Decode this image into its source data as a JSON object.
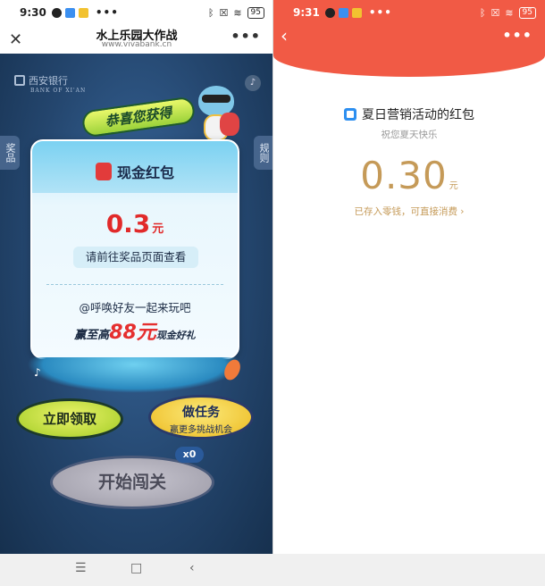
{
  "left": {
    "status": {
      "time": "9:30",
      "battery": "95",
      "dots": "•••"
    },
    "titlebar": {
      "title": "水上乐园大作战",
      "url": "www.vivabank.cn",
      "close_label": "✕",
      "more_label": "•••"
    },
    "game": {
      "bank_name": "西安银行",
      "bank_name_en": "BANK OF XI'AN",
      "tab_prizes": "奖品",
      "tab_rules": "规则",
      "congrats": "恭喜您获得",
      "card": {
        "title": "现金红包",
        "amount": "0.3",
        "amount_unit": "元",
        "view_hint": "请前往奖品页面查看",
        "invite": "@呼唤好友一起来玩吧",
        "reward_pre": "赢至高",
        "reward_big": "88元",
        "reward_post": "现金好礼"
      },
      "btn_claim": "立即领取",
      "btn_task_title": "做任务",
      "btn_task_sub": "赢更多挑战机会",
      "x0": "x0",
      "btn_start": "开始闯关"
    }
  },
  "right": {
    "status": {
      "time": "9:31",
      "battery": "95",
      "dots": "•••"
    },
    "back_label": "‹",
    "more_label": "•••",
    "activity_name": "夏日营销活动的红包",
    "wish": "祝您夏天快乐",
    "amount": "0.30",
    "amount_unit": "元",
    "note": "已存入零钱，可直接消费 ›"
  },
  "navbar": {
    "menu": "☰",
    "home": "□",
    "back": "‹"
  },
  "colors": {
    "header_red": "#f15a45",
    "amount_gold": "#c59a58",
    "amount_red": "#e12a2a"
  }
}
